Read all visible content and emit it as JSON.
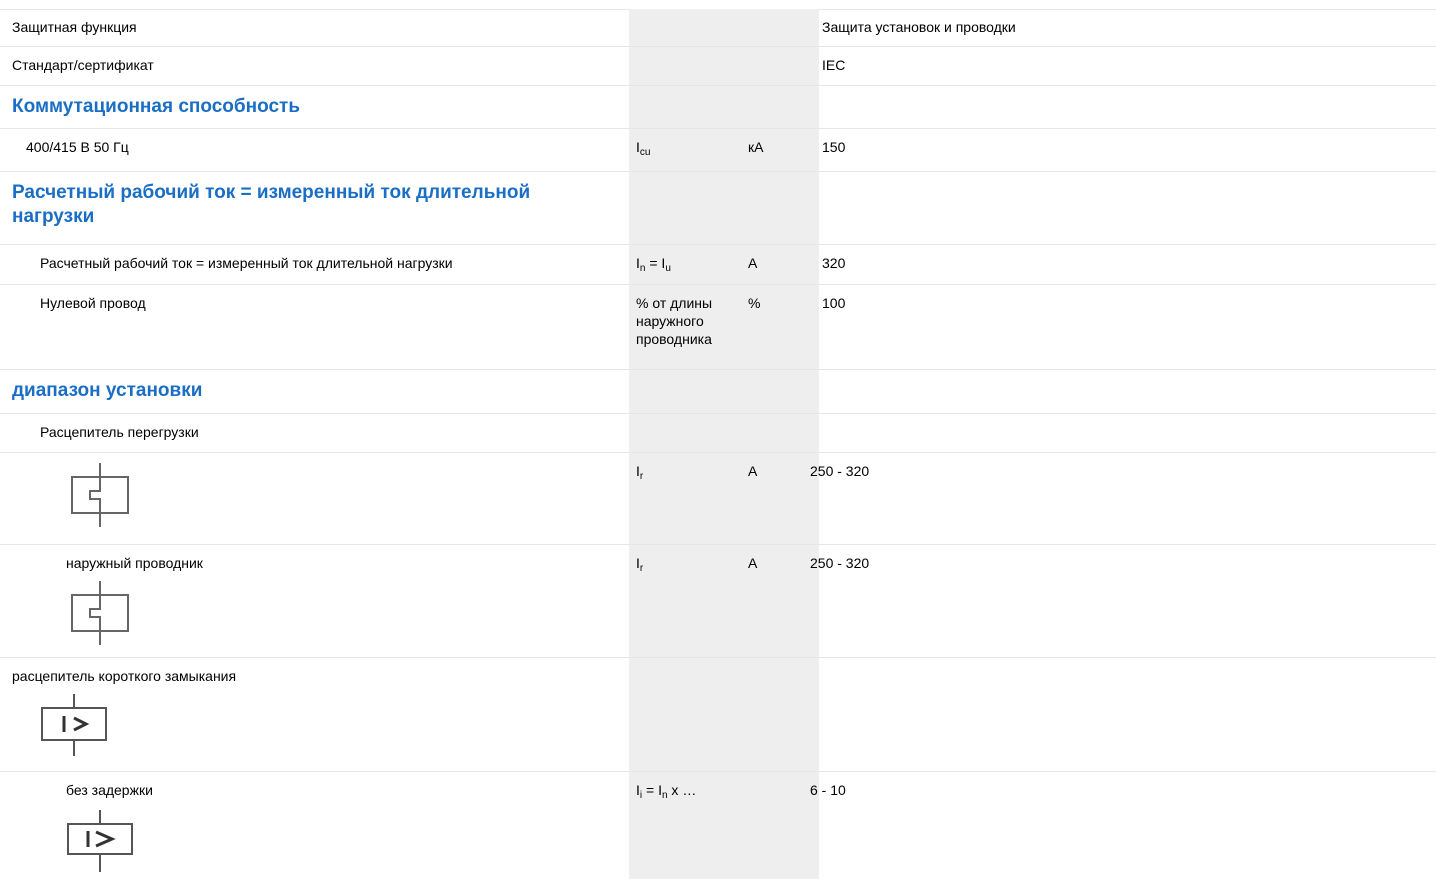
{
  "rows": {
    "r1": {
      "label": "Защитная функция",
      "value": "Защита установок и проводки"
    },
    "r2": {
      "label": "Стандарт/сертификат",
      "value": "IEC"
    },
    "h1": {
      "label": "Коммутационная способность"
    },
    "r3": {
      "label": "400/415 В 50 Гц",
      "sym_main": "I",
      "sym_sub": "cu",
      "unit": "кА",
      "value": "150"
    },
    "h2": {
      "label": "Расчетный рабочий ток = измеренный ток длительной нагрузки"
    },
    "r4": {
      "label": "Расчетный рабочий ток = измеренный ток длительной нагрузки",
      "sym_a": "I",
      "sym_a_sub": "n",
      "sym_eq": " = ",
      "sym_b": "I",
      "sym_b_sub": "u",
      "unit": "A",
      "value": "320"
    },
    "r5": {
      "label": "Нулевой провод",
      "sym": "% от длины наружного проводника",
      "unit": "%",
      "value": "100"
    },
    "h3": {
      "label": "диапазон установки"
    },
    "r6": {
      "label": "Расцепитель перегрузки"
    },
    "r7": {
      "sym_main": "I",
      "sym_sub": "r",
      "unit": "A",
      "value": "250 - 320",
      "icon": "overload-trip-symbol"
    },
    "r8": {
      "label": "наружный проводник",
      "sym_main": "I",
      "sym_sub": "r",
      "unit": "A",
      "value": "250 - 320",
      "icon": "overload-trip-symbol"
    },
    "r9": {
      "label": "расцепитель короткого замыкания",
      "icon": "short-circuit-trip-symbol"
    },
    "r10": {
      "label": "без задержки",
      "sym_a": "I",
      "sym_a_sub": "i",
      "sym_eq": " = ",
      "sym_b": "I",
      "sym_b_sub": "n",
      "sym_tail": " x …",
      "value": "6 - 10",
      "icon": "short-circuit-trip-symbol"
    }
  }
}
